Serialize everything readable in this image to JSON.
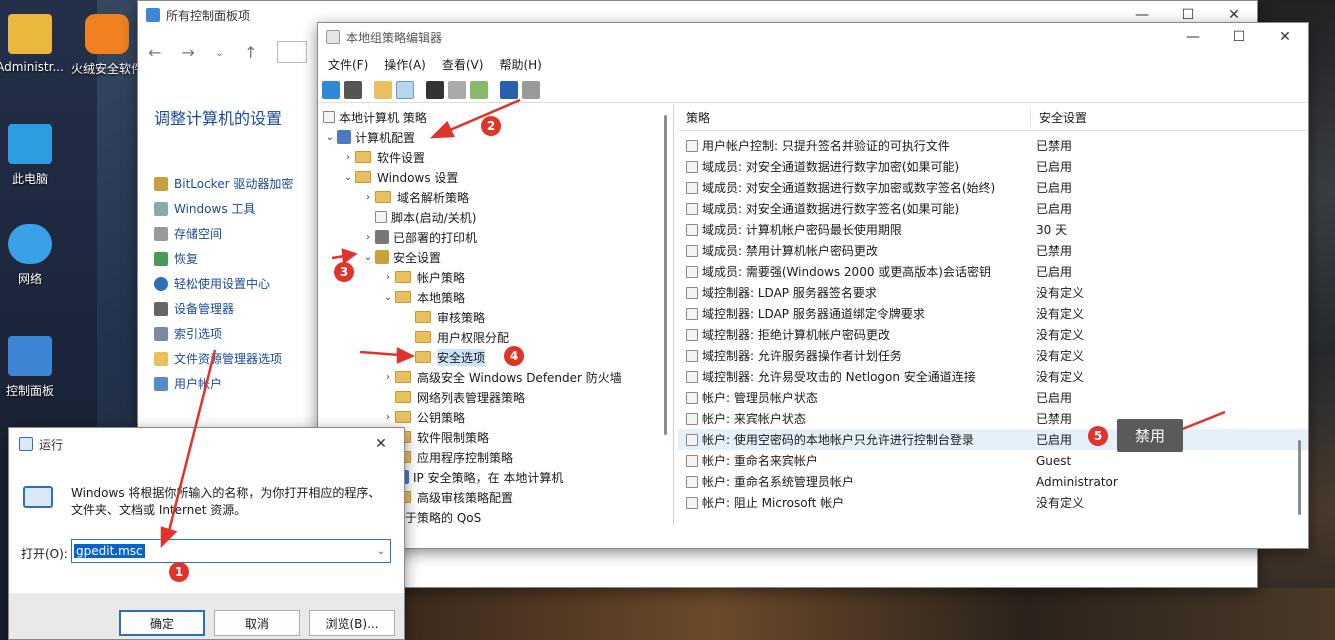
{
  "desktop": {
    "icons": [
      {
        "label": "Administr..."
      },
      {
        "label": "火绒安全软件"
      },
      {
        "label": "此电脑"
      },
      {
        "label": "网络"
      },
      {
        "label": "控制面板"
      }
    ]
  },
  "control_panel": {
    "title": "所有控制面板项",
    "heading": "调整计算机的设置",
    "links": [
      "BitLocker 驱动器加密",
      "Windows 工具",
      "存储空间",
      "恢复",
      "轻松使用设置中心",
      "设备管理器",
      "索引选项",
      "文件资源管理器选项",
      "用户帐户"
    ]
  },
  "gpedit": {
    "title": "本地组策略编辑器",
    "menu": [
      "文件(F)",
      "操作(A)",
      "查看(V)",
      "帮助(H)"
    ],
    "tree": [
      {
        "label": "本地计算机 策略"
      },
      {
        "label": "计算机配置"
      },
      {
        "label": "软件设置"
      },
      {
        "label": "Windows 设置"
      },
      {
        "label": "域名解析策略"
      },
      {
        "label": "脚本(启动/关机)"
      },
      {
        "label": "已部署的打印机"
      },
      {
        "label": "安全设置"
      },
      {
        "label": "帐户策略"
      },
      {
        "label": "本地策略"
      },
      {
        "label": "审核策略"
      },
      {
        "label": "用户权限分配"
      },
      {
        "label": "安全选项"
      },
      {
        "label": "高级安全 Windows Defender 防火墙"
      },
      {
        "label": "网络列表管理器策略"
      },
      {
        "label": "公钥策略"
      },
      {
        "label": "软件限制策略"
      },
      {
        "label": "应用程序控制策略"
      },
      {
        "label": "IP 安全策略，在 本地计算机"
      },
      {
        "label": "高级审核策略配置"
      },
      {
        "label": "基于策略的 QoS"
      }
    ],
    "list_headers": {
      "policy": "策略",
      "setting": "安全设置"
    },
    "rows": [
      {
        "policy": "用户帐户控制: 只提升签名并验证的可执行文件",
        "setting": "已禁用"
      },
      {
        "policy": "域成员: 对安全通道数据进行数字加密(如果可能)",
        "setting": "已启用"
      },
      {
        "policy": "域成员: 对安全通道数据进行数字加密或数字签名(始终)",
        "setting": "已启用"
      },
      {
        "policy": "域成员: 对安全通道数据进行数字签名(如果可能)",
        "setting": "已启用"
      },
      {
        "policy": "域成员: 计算机帐户密码最长使用期限",
        "setting": "30 天"
      },
      {
        "policy": "域成员: 禁用计算机帐户密码更改",
        "setting": "已禁用"
      },
      {
        "policy": "域成员: 需要强(Windows 2000 或更高版本)会话密钥",
        "setting": "已启用"
      },
      {
        "policy": "域控制器: LDAP 服务器签名要求",
        "setting": "没有定义"
      },
      {
        "policy": "域控制器: LDAP 服务器通道绑定令牌要求",
        "setting": "没有定义"
      },
      {
        "policy": "域控制器: 拒绝计算机帐户密码更改",
        "setting": "没有定义"
      },
      {
        "policy": "域控制器: 允许服务器操作者计划任务",
        "setting": "没有定义"
      },
      {
        "policy": "域控制器: 允许易受攻击的 Netlogon 安全通道连接",
        "setting": "没有定义"
      },
      {
        "policy": "帐户: 管理员帐户状态",
        "setting": "已启用"
      },
      {
        "policy": "帐户: 来宾帐户状态",
        "setting": "已禁用"
      },
      {
        "policy": "帐户: 使用空密码的本地帐户只允许进行控制台登录",
        "setting": "已启用"
      },
      {
        "policy": "帐户: 重命名来宾帐户",
        "setting": "Guest"
      },
      {
        "policy": "帐户: 重命名系统管理员帐户",
        "setting": "Administrator"
      },
      {
        "policy": "帐户: 阻止 Microsoft 帐户",
        "setting": "没有定义"
      }
    ]
  },
  "run_dialog": {
    "title": "运行",
    "description": "Windows 将根据你所输入的名称，为你打开相应的程序、文件夹、文档或 Internet 资源。",
    "open_label": "打开(O):",
    "input_value": "gpedit.msc",
    "ok": "确定",
    "cancel": "取消",
    "browse": "浏览(B)..."
  },
  "annotations": {
    "badges": [
      "1",
      "2",
      "3",
      "4",
      "5"
    ],
    "tag": "禁用",
    "color": "#e0342b"
  },
  "colors": {
    "accent": "#2f6fb8",
    "selection": "#cce4f7",
    "link": "#1a4a9a"
  }
}
